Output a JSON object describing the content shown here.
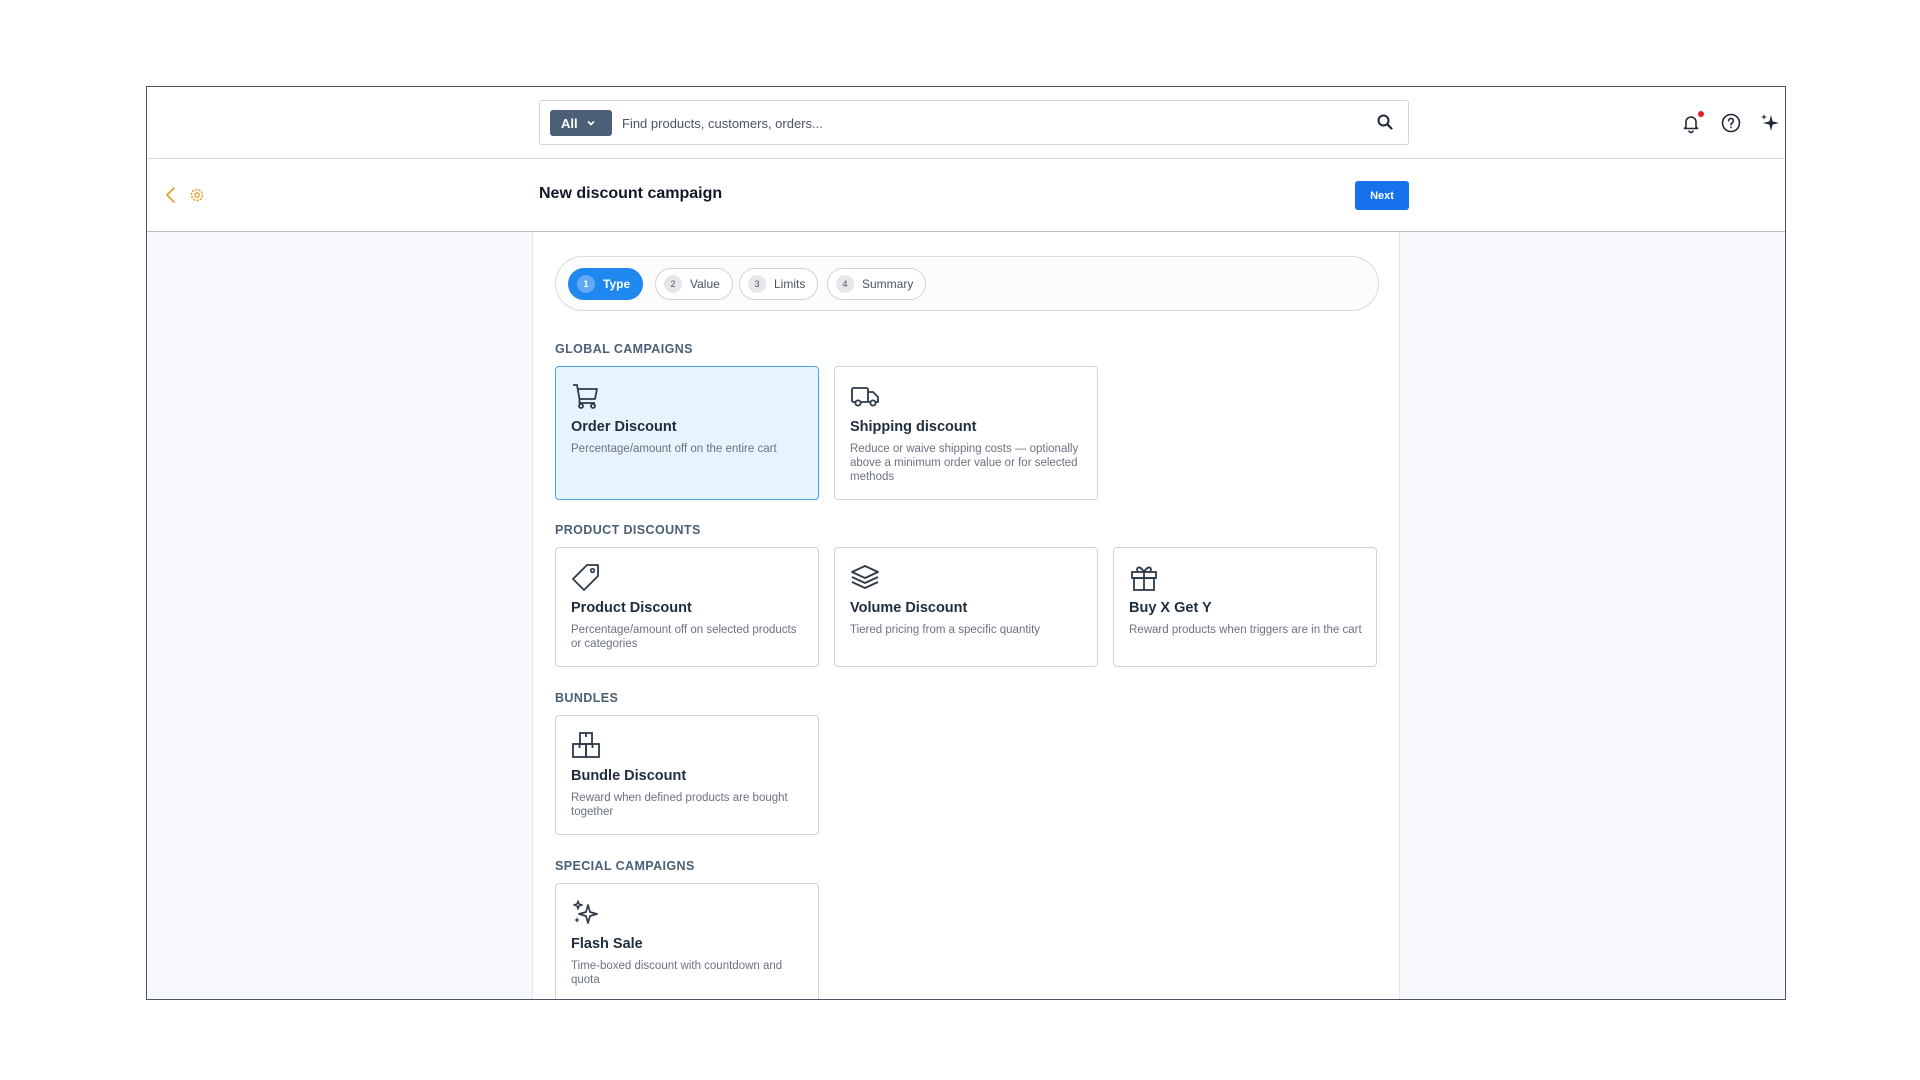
{
  "topbar": {
    "scope_label": "All",
    "search_placeholder": "Find products, customers, orders..."
  },
  "header": {
    "title": "New discount campaign",
    "next_label": "Next"
  },
  "stepper": [
    {
      "num": "1",
      "label": "Type",
      "active": true
    },
    {
      "num": "2",
      "label": "Value",
      "active": false
    },
    {
      "num": "3",
      "label": "Limits",
      "active": false
    },
    {
      "num": "4",
      "label": "Summary",
      "active": false
    }
  ],
  "sections": {
    "global": "GLOBAL CAMPAIGNS",
    "product": "PRODUCT DISCOUNTS",
    "bundles": "BUNDLES",
    "special": "SPECIAL CAMPAIGNS"
  },
  "cards": {
    "order": {
      "title": "Order Discount",
      "desc": "Percentage/amount off on the entire cart",
      "icon": "cart-icon",
      "selected": true
    },
    "shipping": {
      "title": "Shipping discount",
      "desc": "Reduce or waive shipping costs — optionally above a minimum order value or for selected methods",
      "icon": "truck-icon"
    },
    "product": {
      "title": "Product Discount",
      "desc": "Percentage/amount off on selected products or categories",
      "icon": "tag-icon"
    },
    "volume": {
      "title": "Volume Discount",
      "desc": "Tiered pricing from a specific quantity",
      "icon": "layers-icon"
    },
    "bxgy": {
      "title": "Buy X Get Y",
      "desc": "Reward products when triggers are in the cart",
      "icon": "gift-icon"
    },
    "bundle": {
      "title": "Bundle Discount",
      "desc": "Reward when defined products are bought together",
      "icon": "boxes-icon"
    },
    "flash": {
      "title": "Flash Sale",
      "desc": "Time-boxed discount with countdown and quota",
      "icon": "sparkles-icon"
    }
  },
  "colors": {
    "primary": "#1672ec",
    "step_active": "#1e88ef",
    "selected_card_bg": "#e7f3fd",
    "accent_orange": "#e39b2b",
    "notification_dot": "#e11d2e"
  }
}
